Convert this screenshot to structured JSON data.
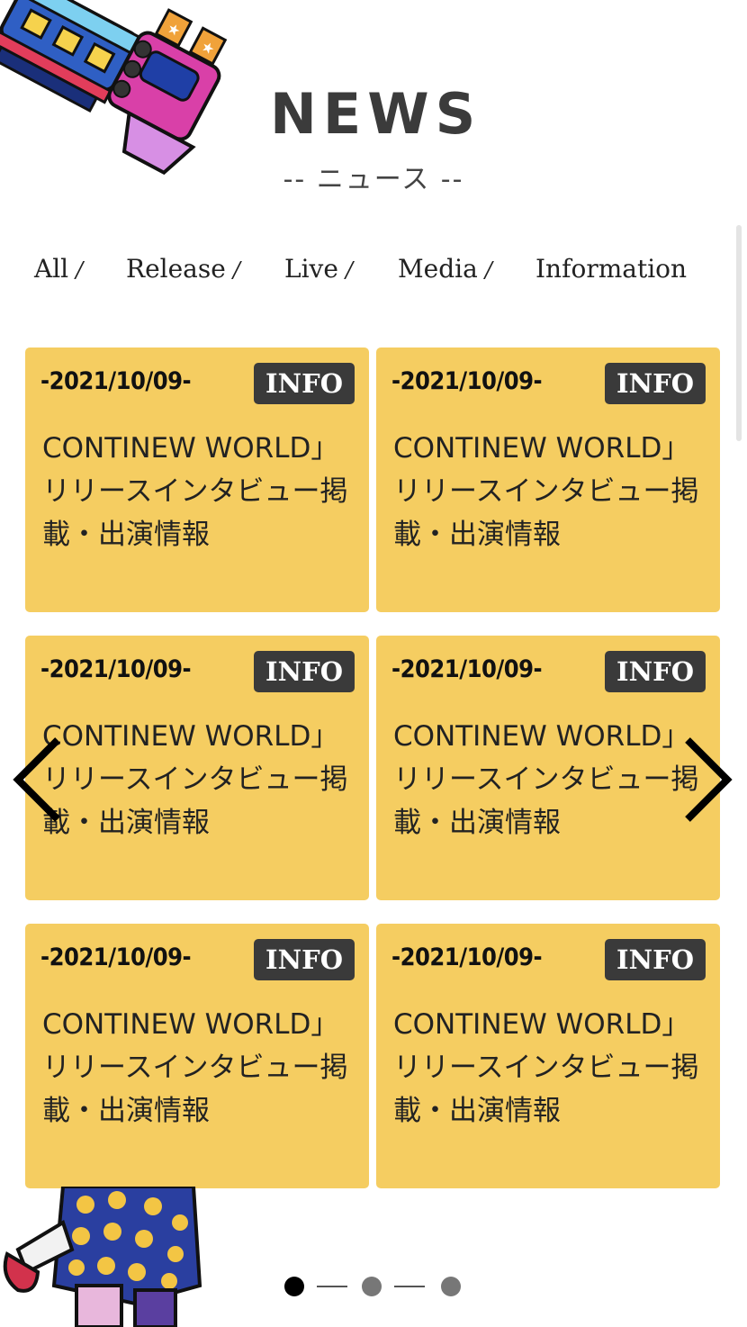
{
  "header": {
    "title": "NEWS",
    "subtitle": "-- ニュース --"
  },
  "tabs": [
    {
      "label": "All",
      "sep": "/"
    },
    {
      "label": "Release",
      "sep": "/"
    },
    {
      "label": "Live",
      "sep": "/"
    },
    {
      "label": "Media",
      "sep": "/"
    },
    {
      "label": "Information",
      "sep": ""
    }
  ],
  "cards": [
    {
      "date": "-2021/10/09-",
      "badge": "INFO",
      "text": "CONTINEW WORLD」リリースインタビュー掲載・出演情報"
    },
    {
      "date": "-2021/10/09-",
      "badge": "INFO",
      "text": "CONTINEW WORLD」リリースインタビュー掲載・出演情報"
    },
    {
      "date": "-2021/10/09-",
      "badge": "INFO",
      "text": "CONTINEW WORLD」リリースインタビュー掲載・出演情報"
    },
    {
      "date": "-2021/10/09-",
      "badge": "INFO",
      "text": "CONTINEW WORLD」リリースインタビュー掲載・出演情報"
    },
    {
      "date": "-2021/10/09-",
      "badge": "INFO",
      "text": "CONTINEW WORLD」リリースインタビュー掲載・出演情報"
    },
    {
      "date": "-2021/10/09-",
      "badge": "INFO",
      "text": "CONTINEW WORLD」リリースインタビュー掲載・出演情報"
    }
  ],
  "pagination": {
    "pages": 3,
    "current": 1
  },
  "colors": {
    "card": "#f5cd61",
    "badge": "#3a3a3a",
    "title": "#3b3b3b"
  },
  "icons": {
    "prev": "chevron-left-icon",
    "next": "chevron-right-icon"
  }
}
